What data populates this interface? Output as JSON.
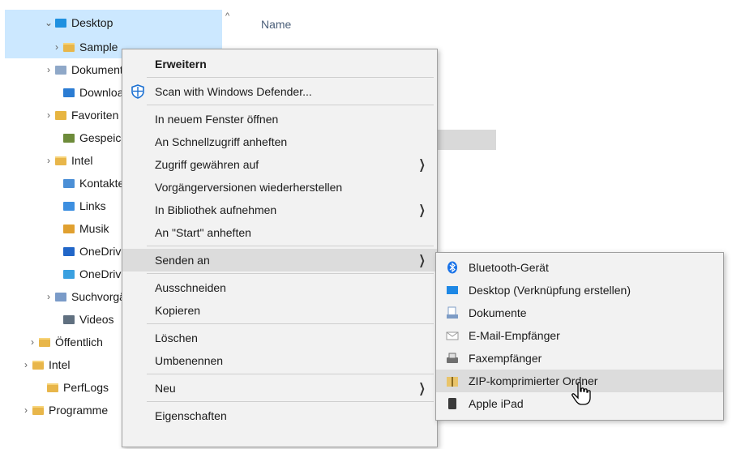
{
  "nav": {
    "items": [
      {
        "label": "Desktop",
        "chev": "v",
        "icon": "desktop-folder-icon",
        "cls": "desk"
      },
      {
        "label": "Sample",
        "chev": ">",
        "icon": "folder-icon",
        "cls": "folder"
      },
      {
        "label": "Dokumente",
        "chev": ">",
        "icon": "documents-folder-icon",
        "cls": "doc"
      },
      {
        "label": "Downloads",
        "chev": "",
        "icon": "downloads-folder-icon",
        "cls": "dl"
      },
      {
        "label": "Favoriten",
        "chev": ">",
        "icon": "favorites-folder-icon",
        "cls": "fav"
      },
      {
        "label": "Gespeicherte Spiele",
        "chev": "",
        "icon": "saved-games-folder-icon",
        "cls": "pic"
      },
      {
        "label": "Intel",
        "chev": ">",
        "icon": "folder-icon",
        "cls": "folder"
      },
      {
        "label": "Kontakte",
        "chev": "",
        "icon": "contacts-folder-icon",
        "cls": "contact"
      },
      {
        "label": "Links",
        "chev": "",
        "icon": "links-folder-icon",
        "cls": "links"
      },
      {
        "label": "Musik",
        "chev": "",
        "icon": "music-folder-icon",
        "cls": "music"
      },
      {
        "label": "OneDrive",
        "chev": "",
        "icon": "onedrive-icon",
        "cls": "cloud"
      },
      {
        "label": "OneDrive",
        "chev": "",
        "icon": "onedrive-shared-icon",
        "cls": "cloud2"
      },
      {
        "label": "Suchvorgänge",
        "chev": ">",
        "icon": "searches-folder-icon",
        "cls": "search"
      },
      {
        "label": "Videos",
        "chev": "",
        "icon": "videos-folder-icon",
        "cls": "video"
      },
      {
        "label": "Öffentlich",
        "chev": ">",
        "icon": "folder-icon",
        "cls": "folder"
      },
      {
        "label": "Intel",
        "chev": ">",
        "icon": "folder-icon",
        "cls": "folder"
      },
      {
        "label": "PerfLogs",
        "chev": "",
        "icon": "folder-icon",
        "cls": "folder"
      },
      {
        "label": "Programme",
        "chev": ">",
        "icon": "folder-icon",
        "cls": "folder"
      }
    ]
  },
  "content": {
    "column_name": "Name"
  },
  "context_menu": {
    "items": [
      {
        "label": "Erweitern",
        "bold": true
      },
      {
        "sep": true
      },
      {
        "label": "Scan with Windows Defender...",
        "icon": "windows-defender-shield-icon"
      },
      {
        "sep": true
      },
      {
        "label": "In neuem Fenster öffnen"
      },
      {
        "label": "An Schnellzugriff anheften"
      },
      {
        "label": "Zugriff gewähren auf",
        "submenu": true
      },
      {
        "label": "Vorgängerversionen wiederherstellen"
      },
      {
        "label": "In Bibliothek aufnehmen",
        "submenu": true
      },
      {
        "label": "An \"Start\" anheften"
      },
      {
        "sep": true
      },
      {
        "label": "Senden an",
        "submenu": true,
        "highlighted": true
      },
      {
        "sep": true
      },
      {
        "label": "Ausschneiden"
      },
      {
        "label": "Kopieren"
      },
      {
        "sep": true
      },
      {
        "label": "Löschen"
      },
      {
        "label": "Umbenennen"
      },
      {
        "sep": true
      },
      {
        "label": "Neu",
        "submenu": true
      },
      {
        "sep": true
      },
      {
        "label": "Eigenschaften"
      }
    ]
  },
  "send_to_menu": {
    "items": [
      {
        "label": "Bluetooth-Gerät",
        "icon": "bluetooth-icon",
        "color": "#1a73e8"
      },
      {
        "label": "Desktop (Verknüpfung erstellen)",
        "icon": "desktop-icon",
        "color": "#1e88e5"
      },
      {
        "label": "Dokumente",
        "icon": "documents-icon",
        "color": "#7d9cc6"
      },
      {
        "label": "E-Mail-Empfänger",
        "icon": "mail-icon",
        "color": "#c8c8c8"
      },
      {
        "label": "Faxempfänger",
        "icon": "fax-icon",
        "color": "#707070"
      },
      {
        "label": "ZIP-komprimierter Ordner",
        "icon": "zip-folder-icon",
        "color": "#e9c46a",
        "highlighted": true
      },
      {
        "label": "Apple iPad",
        "icon": "ipad-icon",
        "color": "#3a3a3a"
      }
    ]
  }
}
